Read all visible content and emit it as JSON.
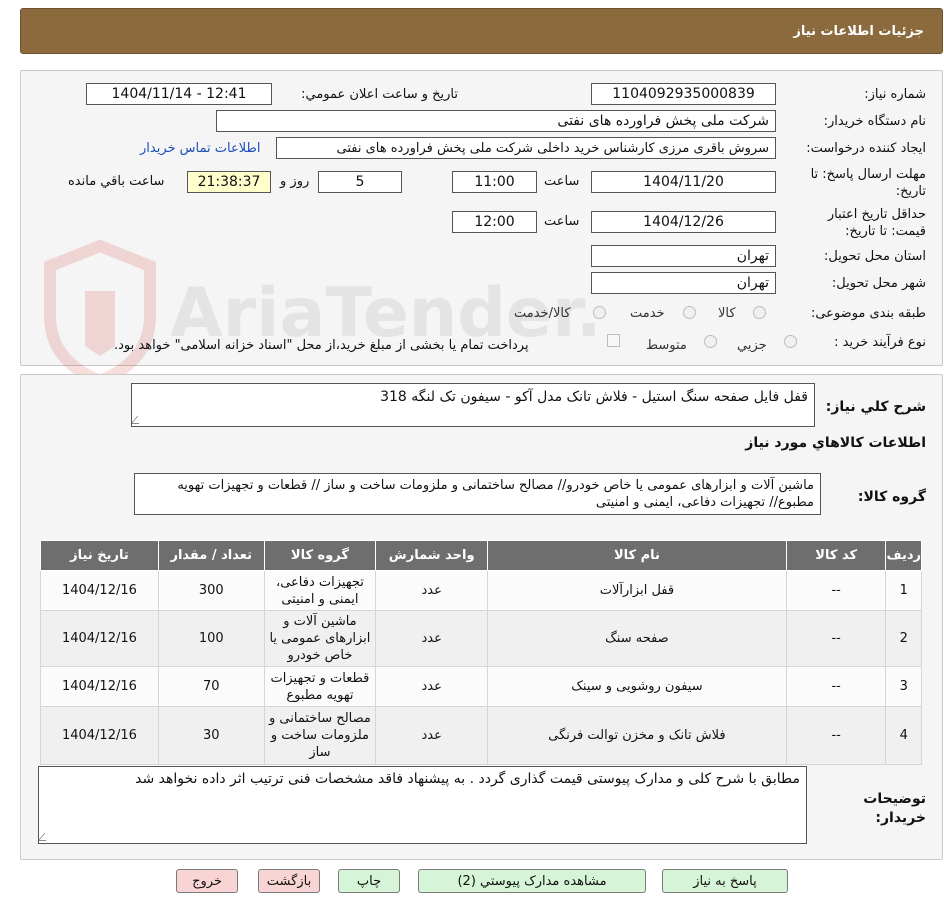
{
  "header": {
    "title": "جزئيات اطلاعات نياز"
  },
  "form": {
    "need_number_label": "شماره نياز:",
    "need_number": "1104092935000839",
    "announce_label": "تاريخ و ساعت اعلان عمومي:",
    "announce_value": "1404/11/14 - 12:41",
    "buyer_org_label": "نام دستگاه خريدار:",
    "buyer_org": "شرکت ملی پخش فراورده های نفتی",
    "creator_label": "ايجاد کننده درخواست:",
    "creator": "سروش باقری مرزی کارشناس خرید داخلی شرکت ملی پخش فراورده های نفتی",
    "contact_link": "اطلاعات تماس خريدار",
    "deadline_label": "مهلت ارسال پاسخ: تا تاريخ:",
    "deadline_date": "1404/11/20",
    "time_label": "ساعت",
    "deadline_time": "11:00",
    "days": "5",
    "days_label": "روز و",
    "remaining_time": "21:38:37",
    "remaining_label": "ساعت باقي مانده",
    "validity_label": "حداقل تاريخ اعتبار قيمت: تا تاريخ:",
    "validity_date": "1404/12/26",
    "validity_time": "12:00",
    "province_label": "استان محل تحويل:",
    "province": "تهران",
    "city_label": "شهر محل تحويل:",
    "city": "تهران",
    "category_label": "طبقه بندی موضوعی:",
    "category_options": [
      "کالا",
      "خدمت",
      "کالا/خدمت"
    ],
    "process_label": "نوع فرآيند خريد :",
    "process_options": [
      "جزيي",
      "متوسط"
    ],
    "process_note": "پرداخت تمام يا بخشی از مبلغ خريد،از محل \"اسناد خزانه اسلامی\" خواهد بود."
  },
  "details": {
    "summary_label": "شرح کلي نياز:",
    "summary": "قفل فایل  صفحه سنگ استیل - فلاش تانک مدل آکو - سیفون تک لنگه 318",
    "items_heading": "اطلاعات کالاهاي مورد نياز",
    "group_label": "گروه کالا:",
    "group_text": "ماشین آلات و ابزارهای عمومی یا خاص خودرو// مصالح ساختمانی و ملزومات ساخت و ساز //  قطعات و تجهیزات تهویه مطبوع// تجهیزات دفاعی، ایمنی و امنیتی",
    "columns": [
      "رديف",
      "کد کالا",
      "نام کالا",
      "واحد شمارش",
      "گروه کالا",
      "تعداد / مقدار",
      "تاريخ نياز"
    ],
    "rows": [
      {
        "idx": "1",
        "code": "--",
        "name": "قفل ابزارآلات",
        "unit": "عدد",
        "group": "تجهیزات دفاعی، ایمنی و امنیتی",
        "qty": "300",
        "date": "1404/12/16"
      },
      {
        "idx": "2",
        "code": "--",
        "name": "صفحه سنگ",
        "unit": "عدد",
        "group": "ماشین آلات و ابزارهای عمومی یا خاص خودرو",
        "qty": "100",
        "date": "1404/12/16"
      },
      {
        "idx": "3",
        "code": "--",
        "name": "سیفون روشویی و سینک",
        "unit": "عدد",
        "group": "قطعات و تجهیزات تهویه مطبوع",
        "qty": "70",
        "date": "1404/12/16"
      },
      {
        "idx": "4",
        "code": "--",
        "name": "فلاش تانک و مخزن توالت فرنگی",
        "unit": "عدد",
        "group": "مصالح ساختمانی و ملزومات ساخت و ساز",
        "qty": "30",
        "date": "1404/12/16"
      }
    ],
    "notes_label": "توضيحات خريدار:",
    "notes": "مطابق با شرح کلی و مدارک پیوستی قیمت گذاری گردد . به پیشنهاد فاقد مشخصات فنی ترتیب اثر داده نخواهد شد"
  },
  "buttons": {
    "reply": "پاسخ به نياز",
    "attachments": "مشاهده مدارک پيوستي (2)",
    "print": "چاپ",
    "back": "بازگشت",
    "exit": "خروج"
  },
  "watermark": "AriaTender.neT"
}
